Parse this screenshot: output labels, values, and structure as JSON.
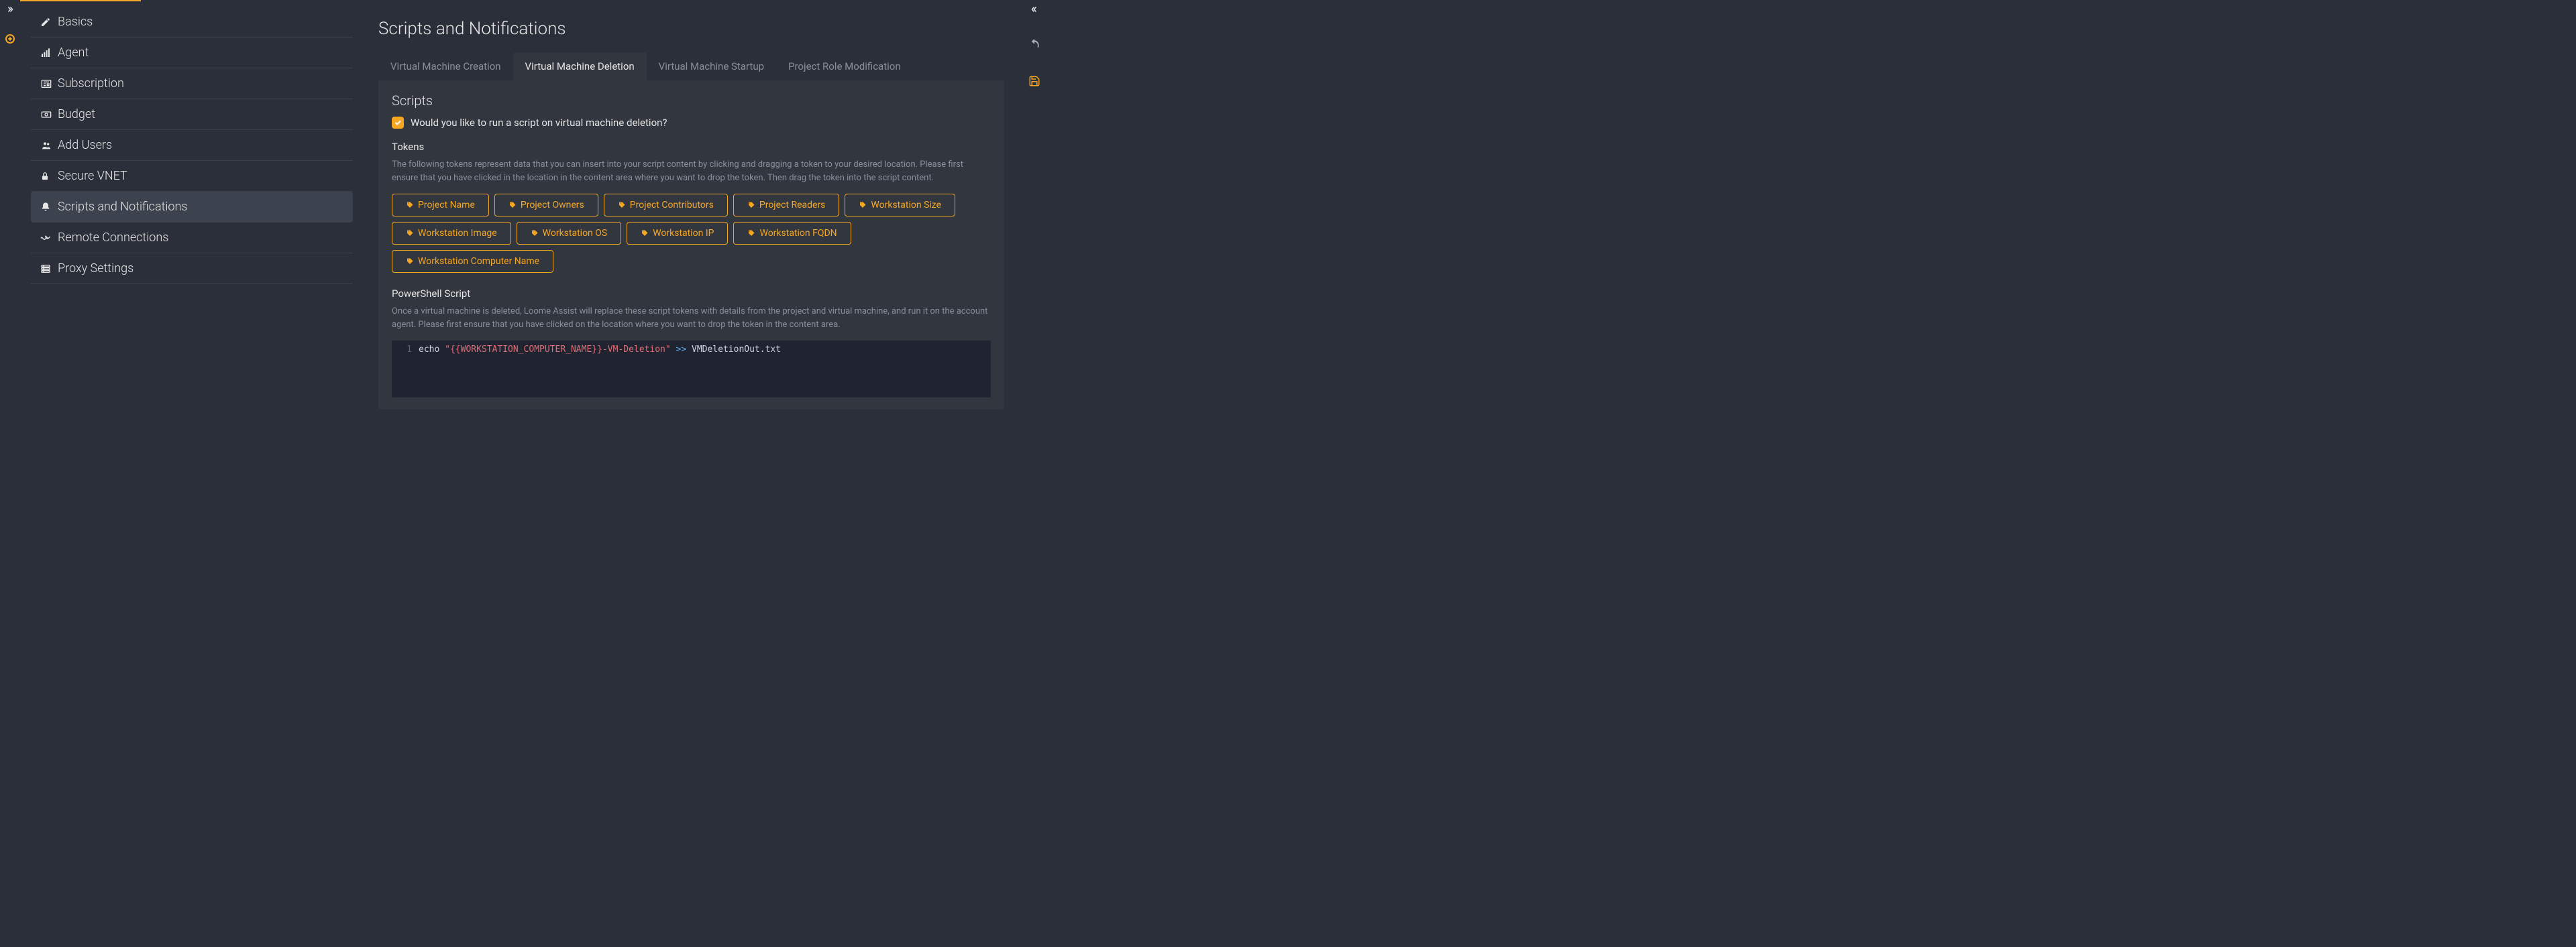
{
  "sidebar": {
    "items": [
      {
        "label": "Basics",
        "icon": "pencil"
      },
      {
        "label": "Agent",
        "icon": "bars"
      },
      {
        "label": "Subscription",
        "icon": "newspaper"
      },
      {
        "label": "Budget",
        "icon": "money"
      },
      {
        "label": "Add Users",
        "icon": "users"
      },
      {
        "label": "Secure VNET",
        "icon": "lock"
      },
      {
        "label": "Scripts and Notifications",
        "icon": "bell"
      },
      {
        "label": "Remote Connections",
        "icon": "plug"
      },
      {
        "label": "Proxy Settings",
        "icon": "server"
      }
    ]
  },
  "page": {
    "title": "Scripts and Notifications"
  },
  "tabs": [
    {
      "label": "Virtual Machine Creation"
    },
    {
      "label": "Virtual Machine Deletion"
    },
    {
      "label": "Virtual Machine Startup"
    },
    {
      "label": "Project Role Modification"
    }
  ],
  "scripts": {
    "heading": "Scripts",
    "checkbox_label": "Would you like to run a script on virtual machine deletion?",
    "tokens_heading": "Tokens",
    "tokens_help": "The following tokens represent data that you can insert into your script content by clicking and dragging a token to your desired location. Please first ensure that you have clicked in the location in the content area where you want to drop the token. Then drag the token into the script content.",
    "tokens": [
      "Project Name",
      "Project Owners",
      "Project Contributors",
      "Project Readers",
      "Workstation Size",
      "Workstation Image",
      "Workstation OS",
      "Workstation IP",
      "Workstation FQDN",
      "Workstation Computer Name"
    ],
    "ps_heading": "PowerShell Script",
    "ps_help": "Once a virtual machine is deleted, Loome Assist will replace these script tokens with details from the project and virtual machine, and run it on the account agent. Please first ensure that you have clicked on the location where you want to drop the token in the content area.",
    "code": {
      "line_no": "1",
      "echo": "echo",
      "string": "\"{{WORKSTATION_COMPUTER_NAME}}-VM-Deletion\"",
      "op": ">>",
      "file": "VMDeletionOut.txt"
    }
  }
}
